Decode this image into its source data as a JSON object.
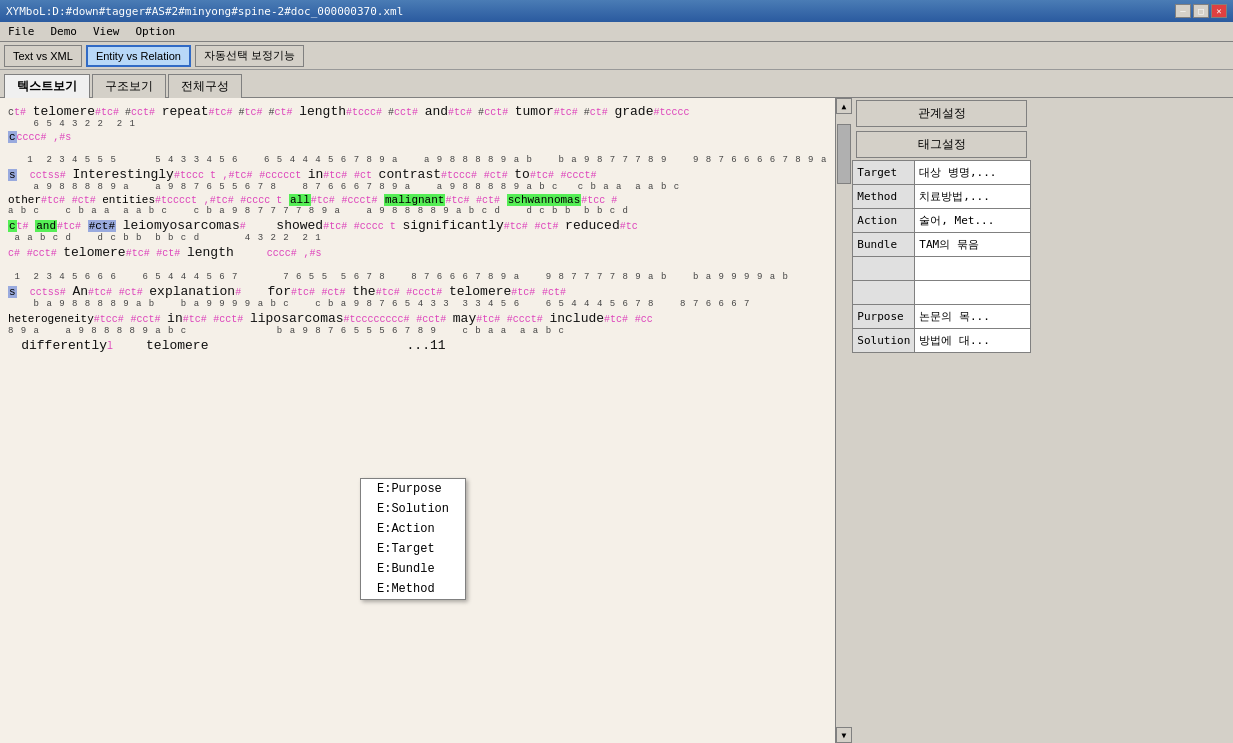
{
  "titlebar": {
    "title": "XYMboL:D:#down#tagger#AS#2#minyong#spine-2#doc_000000370.xml",
    "buttons": [
      "—",
      "□",
      "✕"
    ]
  },
  "menubar": {
    "items": [
      "File",
      "Demo",
      "View",
      "Option"
    ]
  },
  "toolbar": {
    "buttons": [
      "Text vs XML",
      "Entity vs Relation",
      "자동선택 보정기능"
    ]
  },
  "tabs": {
    "items": [
      "텍스트보기",
      "구조보기",
      "전체구성"
    ]
  },
  "rightpanel": {
    "btn1": "관계설정",
    "btn2": "태그설정",
    "table": [
      {
        "label": "Target",
        "value": "대상 병명,..."
      },
      {
        "label": "Method",
        "value": "치료방법,..."
      },
      {
        "label": "Action",
        "value": "술어, Met..."
      },
      {
        "label": "Bundle",
        "value": "TAM의 묶음"
      },
      {
        "label": "",
        "value": ""
      },
      {
        "label": "",
        "value": ""
      },
      {
        "label": "Purpose",
        "value": "논문의 목..."
      },
      {
        "label": "Solution",
        "value": "방법에 대..."
      }
    ]
  },
  "contextmenu": {
    "items": [
      "E:Purpose",
      "E:Solution",
      "E:Action",
      "E:Target",
      "E:Bundle",
      "E:Method"
    ]
  },
  "content": {
    "lines": [
      "telomere repeat length and tumor grade",
      "Interestingly, in contrast to other entities, all malignant schwannomas",
      "and leiomyosarcomas showed significantly reduced",
      "telomere length",
      "An explanation for the telomere",
      "heterogeneity in liposarcomas may include"
    ]
  }
}
